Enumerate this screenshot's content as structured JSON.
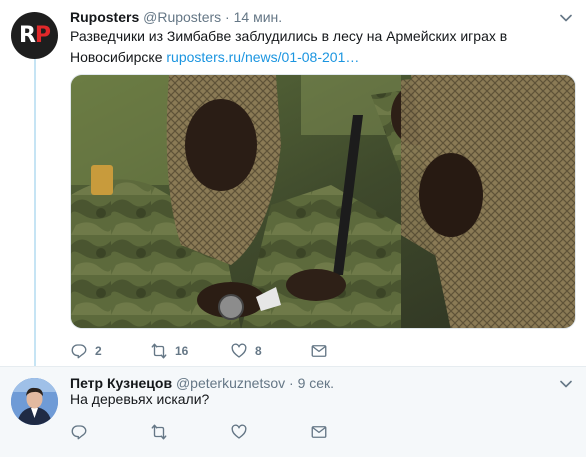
{
  "tweet": {
    "name": "Ruposters",
    "handle": "@Ruposters",
    "separator": "·",
    "time": "14 мин.",
    "avatar_letters": {
      "first": "R",
      "second": "P"
    },
    "text": "Разведчики из Зимбабве заблудились в лесу на Армейских играх в Новосибирске",
    "link": "ruposters.ru/news/01-08-201…",
    "stats": {
      "replies": "2",
      "retweets": "16",
      "likes": "8"
    }
  },
  "reply": {
    "name": "Петр Кузнецов",
    "handle": "@peterkuznetsov",
    "separator": "·",
    "time": "9 сек.",
    "text": "На деревьях искали?"
  },
  "colors": {
    "link": "#1b95e0",
    "muted": "#657786",
    "thread": "#c6e4f4",
    "reply_bg": "#f5f8fa"
  },
  "icons": [
    "reply-icon",
    "retweet-icon",
    "like-icon",
    "direct-message-icon",
    "chevron-down-icon"
  ]
}
